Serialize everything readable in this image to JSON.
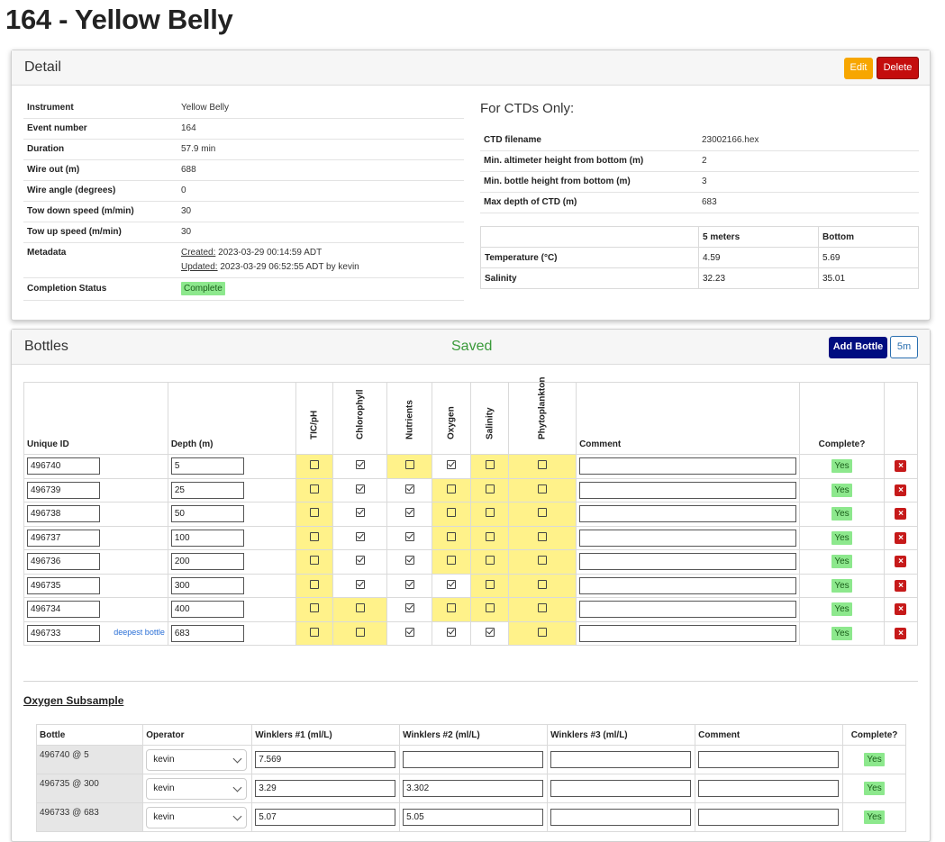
{
  "page_title": "164 - Yellow Belly",
  "detail": {
    "title": "Detail",
    "edit_label": "Edit",
    "delete_label": "Delete",
    "fields": [
      {
        "label": "Instrument",
        "value": "Yellow Belly"
      },
      {
        "label": "Event number",
        "value": "164"
      },
      {
        "label": "Duration",
        "value": "57.9 min"
      },
      {
        "label": "Wire out (m)",
        "value": "688"
      },
      {
        "label": "Wire angle (degrees)",
        "value": "0"
      },
      {
        "label": "Tow down speed (m/min)",
        "value": "30"
      },
      {
        "label": "Tow up speed (m/min)",
        "value": "30"
      }
    ],
    "metadata_label": "Metadata",
    "created_label": "Created:",
    "created_value": " 2023-03-29 00:14:59 ADT",
    "updated_label": "Updated:",
    "updated_value": " 2023-03-29 06:52:55 ADT by kevin",
    "completion_label": "Completion Status",
    "completion_value": "Complete",
    "ctd_heading": "For CTDs Only:",
    "ctd_fields": [
      {
        "label": "CTD filename",
        "value": "23002166.hex"
      },
      {
        "label": "Min. altimeter height from bottom (m)",
        "value": "2"
      },
      {
        "label": "Min. bottle height from bottom (m)",
        "value": "3"
      },
      {
        "label": "Max depth of CTD (m)",
        "value": "683"
      }
    ],
    "ctd_table": {
      "headers": [
        "",
        "5 meters",
        "Bottom"
      ],
      "rows": [
        {
          "label": "Temperature (°C)",
          "v1": "4.59",
          "v2": "5.69"
        },
        {
          "label": "Salinity",
          "v1": "32.23",
          "v2": "35.01"
        }
      ]
    }
  },
  "bottles": {
    "title": "Bottles",
    "status": "Saved",
    "add_label": "Add Bottle",
    "preset_label": "5m",
    "headers": {
      "unique_id": "Unique ID",
      "depth": "Depth (m)",
      "tic": "TIC/pH",
      "chl": "Chlorophyll",
      "nut": "Nutrients",
      "oxy": "Oxygen",
      "sal": "Salinity",
      "phy": "Phytoplankton",
      "comment": "Comment",
      "complete": "Complete?"
    },
    "deepest_label": "deepest bottle",
    "rows": [
      {
        "id": "496740",
        "depth": "5",
        "complete": "Yes",
        "checks": [
          false,
          true,
          false,
          true,
          false,
          false
        ],
        "yellow": [
          true,
          false,
          true,
          false,
          true,
          true
        ]
      },
      {
        "id": "496739",
        "depth": "25",
        "complete": "Yes",
        "checks": [
          false,
          true,
          true,
          false,
          false,
          false
        ],
        "yellow": [
          true,
          false,
          false,
          true,
          true,
          true
        ]
      },
      {
        "id": "496738",
        "depth": "50",
        "complete": "Yes",
        "checks": [
          false,
          true,
          true,
          false,
          false,
          false
        ],
        "yellow": [
          true,
          false,
          false,
          true,
          true,
          true
        ]
      },
      {
        "id": "496737",
        "depth": "100",
        "complete": "Yes",
        "checks": [
          false,
          true,
          true,
          false,
          false,
          false
        ],
        "yellow": [
          true,
          false,
          false,
          true,
          true,
          true
        ]
      },
      {
        "id": "496736",
        "depth": "200",
        "complete": "Yes",
        "checks": [
          false,
          true,
          true,
          false,
          false,
          false
        ],
        "yellow": [
          true,
          false,
          false,
          true,
          true,
          true
        ]
      },
      {
        "id": "496735",
        "depth": "300",
        "complete": "Yes",
        "checks": [
          false,
          true,
          true,
          true,
          false,
          false
        ],
        "yellow": [
          true,
          false,
          false,
          false,
          true,
          true
        ]
      },
      {
        "id": "496734",
        "depth": "400",
        "complete": "Yes",
        "checks": [
          false,
          false,
          true,
          false,
          false,
          false
        ],
        "yellow": [
          true,
          true,
          false,
          true,
          true,
          true
        ]
      },
      {
        "id": "496733",
        "depth": "683",
        "complete": "Yes",
        "checks": [
          false,
          false,
          true,
          true,
          true,
          false
        ],
        "yellow": [
          true,
          true,
          false,
          false,
          false,
          true
        ],
        "deepest": true
      }
    ]
  },
  "oxygen": {
    "title": "Oxygen Subsample",
    "headers": [
      "Bottle",
      "Operator",
      "Winklers #1 (ml/L)",
      "Winklers #2 (ml/L)",
      "Winklers #3 (ml/L)",
      "Comment",
      "Complete?"
    ],
    "rows": [
      {
        "bottle": "496740 @ 5",
        "operator": "kevin",
        "w1": "7.569",
        "w2": "",
        "w3": "",
        "comment": "",
        "complete": "Yes"
      },
      {
        "bottle": "496735 @ 300",
        "operator": "kevin",
        "w1": "3.29",
        "w2": "3.302",
        "w3": "",
        "comment": "",
        "complete": "Yes"
      },
      {
        "bottle": "496733 @ 683",
        "operator": "kevin",
        "w1": "5.07",
        "w2": "5.05",
        "w3": "",
        "comment": "",
        "complete": "Yes"
      }
    ]
  },
  "colors": {
    "edit": "#f7a600",
    "delete": "#c40d0d",
    "add": "#000d80",
    "saved": "#3a9a3a",
    "yellow_cell": "#fff28a",
    "complete": "#8de88d"
  }
}
